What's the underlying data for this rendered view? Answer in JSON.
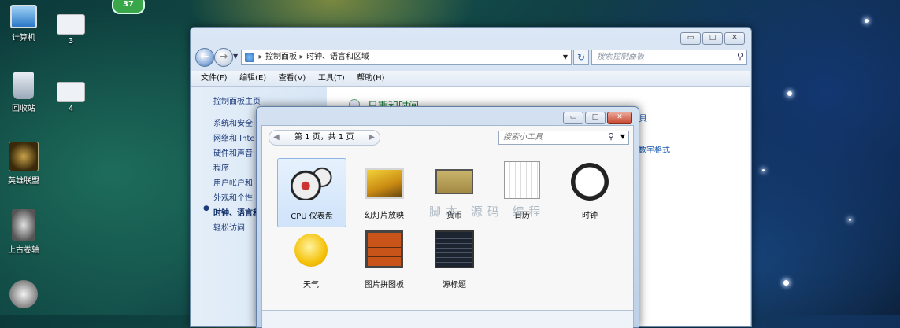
{
  "desktop": {
    "badge": "37",
    "icons": [
      {
        "label": "计算机"
      },
      {
        "label": "3"
      },
      {
        "label": "回收站"
      },
      {
        "label": "4"
      },
      {
        "label": "英雄联盟"
      },
      {
        "label": "上古卷轴"
      }
    ]
  },
  "explorer": {
    "breadcrumb": [
      "控制面板",
      "时钟、语言和区域"
    ],
    "search_placeholder": "搜索控制面板",
    "menu": [
      "文件(F)",
      "编辑(E)",
      "查看(V)",
      "工具(T)",
      "帮助(H)"
    ],
    "sidebar": [
      "控制面板主页",
      "系统和安全",
      "网络和 Inte",
      "硬件和声音",
      "程序",
      "用户帐户和",
      "外观和个性",
      "时钟、语言和",
      "轻松访问"
    ],
    "content_title": "日期和时间",
    "content_link_1": "具",
    "content_link_2": "数字格式"
  },
  "gadgets": {
    "page_label": "第 1 页，共 1 页",
    "search_placeholder": "搜索小工具",
    "items": [
      {
        "label": "CPU 仪表盘"
      },
      {
        "label": "幻灯片放映"
      },
      {
        "label": "货币"
      },
      {
        "label": "日历"
      },
      {
        "label": "时钟"
      },
      {
        "label": "天气"
      },
      {
        "label": "图片拼图板"
      },
      {
        "label": "源标题"
      }
    ],
    "watermark": "脚本 源码 编程"
  }
}
